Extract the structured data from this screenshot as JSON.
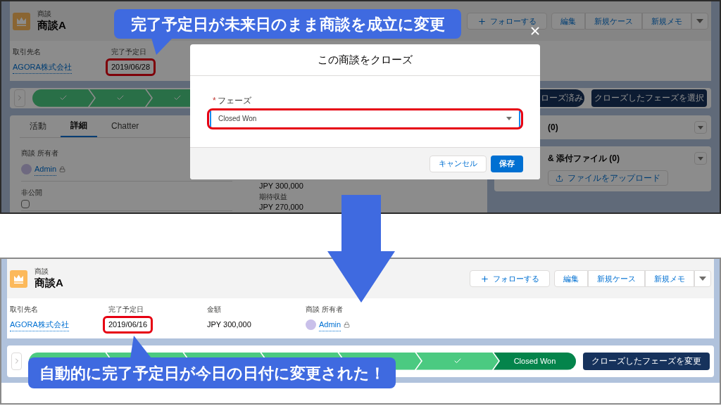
{
  "top_callout": {
    "text": "完了予定日が未来日のまま商談を成立に変更"
  },
  "before": {
    "object_label": "商談",
    "record_name": "商談A",
    "actions": [
      {
        "label": "フォローする",
        "kind": "follow"
      },
      {
        "label": "編集",
        "kind": "group"
      },
      {
        "label": "新規ケース",
        "kind": "group"
      },
      {
        "label": "新規メモ",
        "kind": "group"
      },
      {
        "kind": "menu"
      }
    ],
    "fields": [
      {
        "label": "取引先名",
        "value": "AGORA株式会社",
        "kind": "link",
        "highlighted": false
      },
      {
        "label": "完了予定日",
        "value": "2019/06/28",
        "kind": "text",
        "highlighted": true
      }
    ],
    "path": {
      "steps": [
        {
          "kind": "done"
        },
        {
          "kind": "done"
        },
        {
          "kind": "done"
        }
      ],
      "stage": "ローズ済み",
      "button": "クローズしたフェーズを選択"
    },
    "tabs": [
      {
        "label": "活動",
        "selected": false
      },
      {
        "label": "詳細",
        "selected": true
      },
      {
        "label": "Chatter",
        "selected": false
      }
    ],
    "details_left": [
      {
        "label": "商談 所有者",
        "value": "Admin",
        "kind": "user"
      },
      {
        "label": "非公開",
        "kind": "checkbox",
        "checked": false
      }
    ],
    "details_right": [
      {
        "value": "JPY 300,000"
      },
      {
        "label": "期待収益",
        "value": "JPY 270,000"
      }
    ],
    "related": [
      {
        "title": "(0)"
      },
      {
        "title": "& 添付ファイル (0)",
        "upload": "ファイルをアップロード"
      }
    ],
    "modal": {
      "title": "この商談をクローズ",
      "field_label": "フェーズ",
      "required_mark": "*",
      "value": "Closed Won",
      "highlighted": true,
      "buttons": [
        {
          "label": "キャンセル",
          "kind": "neutral"
        },
        {
          "label": "保存",
          "kind": "brand"
        }
      ]
    }
  },
  "after": {
    "object_label": "商談",
    "record_name": "商談A",
    "actions": [
      {
        "label": "フォローする",
        "kind": "follow"
      },
      {
        "label": "編集",
        "kind": "group"
      },
      {
        "label": "新規ケース",
        "kind": "group"
      },
      {
        "label": "新規メモ",
        "kind": "group"
      },
      {
        "kind": "menu"
      }
    ],
    "fields": [
      {
        "label": "取引先名",
        "value": "AGORA株式会社",
        "kind": "link",
        "highlighted": false
      },
      {
        "label": "完了予定日",
        "value": "2019/06/16",
        "kind": "text",
        "highlighted": true
      },
      {
        "label": "金額",
        "value": "JPY 300,000",
        "kind": "text",
        "highlighted": false
      },
      {
        "label": "商談 所有者",
        "value": "Admin",
        "kind": "user",
        "highlighted": false
      }
    ],
    "path": {
      "steps": [
        {
          "kind": "done"
        },
        {
          "kind": "done"
        },
        {
          "kind": "done"
        },
        {
          "kind": "done"
        },
        {
          "kind": "done"
        },
        {
          "kind": "done"
        },
        {
          "kind": "current",
          "label": "Closed Won"
        }
      ],
      "button": "クローズしたフェーズを変更"
    }
  },
  "bottom_callout": {
    "text": "自動的に完了予定日が今日の日付に変更された！"
  }
}
